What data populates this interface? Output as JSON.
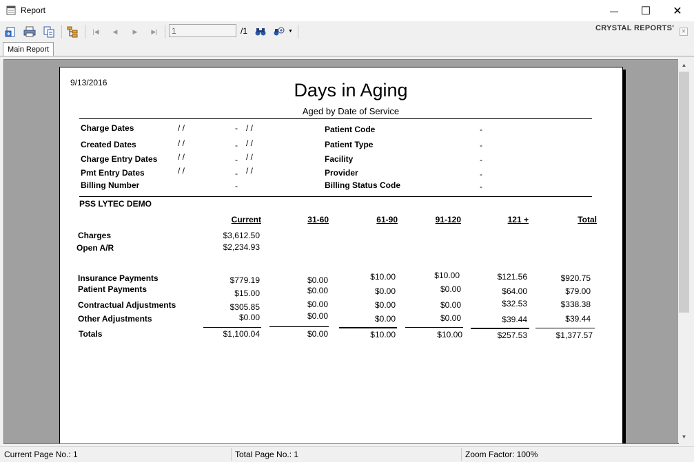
{
  "window": {
    "title": "Report",
    "minimize": "—",
    "maximize": "☐",
    "close": "✕"
  },
  "toolbar": {
    "page_value": "1",
    "page_total": "/1",
    "brand": "CRYSTAL REPORTS'",
    "brand_close": "✕",
    "icons": [
      "export-icon",
      "print-icon",
      "copy-icon",
      "group-tree-icon",
      "first-page-icon",
      "previous-page-icon",
      "next-page-icon",
      "last-page-icon",
      "find-icon",
      "zoom-icon"
    ]
  },
  "tabs": [
    {
      "label": "Main Report"
    }
  ],
  "report": {
    "date": "9/13/2016",
    "title": "Days in Aging",
    "subtitle": "Aged by Date of Service",
    "params_left": [
      {
        "label": "Charge Dates",
        "from": "/ /",
        "dash": "-",
        "to": "/ /"
      },
      {
        "label": "Created Dates",
        "from": "/ /",
        "dash": "-",
        "to": "/ /"
      },
      {
        "label": "Charge Entry Dates",
        "from": "/ /",
        "dash": "-",
        "to": "/ /"
      },
      {
        "label": "Pmt Entry Dates",
        "from": "/ /",
        "dash": "-",
        "to": "/ /"
      },
      {
        "label": "Billing Number",
        "from": "",
        "dash": "-",
        "to": ""
      }
    ],
    "params_right": [
      {
        "label": "Patient Code",
        "value": "-"
      },
      {
        "label": "Patient Type",
        "value": "-"
      },
      {
        "label": "Facility",
        "value": "-"
      },
      {
        "label": "Provider",
        "value": "-"
      },
      {
        "label": "Billing Status Code",
        "value": "-"
      }
    ],
    "practice": "PSS LYTEC DEMO",
    "columns": [
      "Current",
      "31-60",
      "61-90",
      "91-120",
      "121 +",
      "Total"
    ],
    "charges_label": "Charges",
    "charges_value": "$3,612.50",
    "open_ar_label": "Open A/R",
    "open_ar_value": "$2,234.93",
    "rows": [
      {
        "label": "Insurance Payments",
        "values": [
          "$779.19",
          "$0.00",
          "$10.00",
          "$10.00",
          "$121.56",
          "$920.75"
        ]
      },
      {
        "label": "Patient Payments",
        "values": [
          "$15.00",
          "$0.00",
          "$0.00",
          "$0.00",
          "$64.00",
          "$79.00"
        ]
      },
      {
        "label": "Contractual Adjustments",
        "values": [
          "$305.85",
          "$0.00",
          "$0.00",
          "$0.00",
          "$32.53",
          "$338.38"
        ]
      },
      {
        "label": "Other Adjustments",
        "values": [
          "$0.00",
          "$0.00",
          "$0.00",
          "$0.00",
          "$39.44",
          "$39.44"
        ]
      }
    ],
    "totals": {
      "label": "Totals",
      "values": [
        "$1,100.04",
        "$0.00",
        "$10.00",
        "$10.00",
        "$257.53",
        "$1,377.57"
      ]
    }
  },
  "statusbar": {
    "current_page": "Current Page No.: 1",
    "total_page": "Total Page No.: 1",
    "zoom": "Zoom Factor: 100%"
  }
}
